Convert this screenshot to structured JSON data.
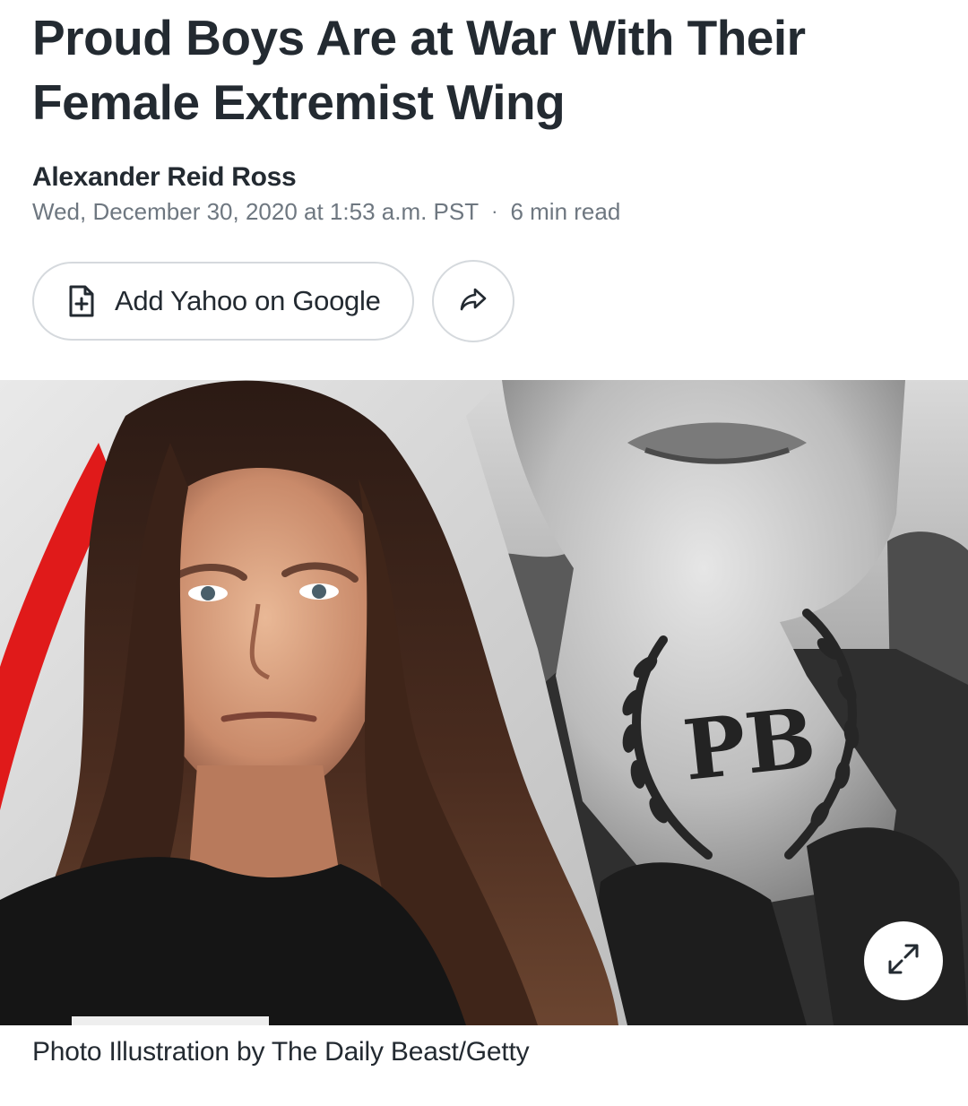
{
  "article": {
    "headline": "Proud Boys Are at War With Their Female Extremist Wing",
    "author": "Alexander Reid Ross",
    "date": "Wed, December 30, 2020 at 1:53 a.m. PST",
    "separator": "·",
    "read_time": "6 min read"
  },
  "actions": {
    "add_google_label": "Add Yahoo on Google",
    "add_google_icon": "document-plus-icon",
    "share_icon": "share-arrow-icon"
  },
  "hero_image": {
    "tattoo_text": "PB",
    "expand_icon": "expand-arrows-icon",
    "caption": "Photo Illustration by The Daily Beast/Getty"
  },
  "colors": {
    "text_primary": "#232a31",
    "text_secondary": "#6e7780",
    "border": "#d5d9dd"
  }
}
